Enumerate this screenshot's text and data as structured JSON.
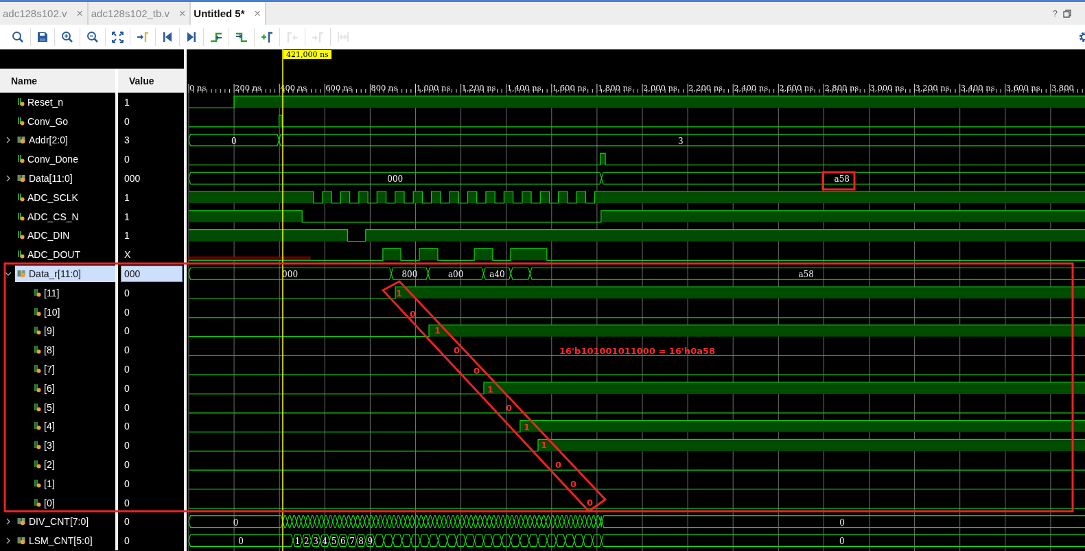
{
  "tabs": [
    {
      "label": "adc128s102.v",
      "close": "×",
      "selected": false
    },
    {
      "label": "adc128s102_tb.v",
      "close": "×",
      "selected": false
    },
    {
      "label": "Untitled 5*",
      "close": "×",
      "selected": true
    }
  ],
  "window_controls": {
    "help": "?"
  },
  "toolbar": [
    {
      "kind": "search",
      "disabled": false
    },
    {
      "kind": "save",
      "disabled": false
    },
    {
      "kind": "zoom-in",
      "disabled": false
    },
    {
      "kind": "zoom-out",
      "disabled": false
    },
    {
      "kind": "zoom-fit",
      "disabled": false
    },
    {
      "kind": "go-to-cursor",
      "disabled": false
    },
    {
      "kind": "go-to-start",
      "disabled": false
    },
    {
      "kind": "go-to-end",
      "disabled": false
    },
    {
      "kind": "previous-transition",
      "disabled": false
    },
    {
      "kind": "next-transition",
      "disabled": false
    },
    {
      "kind": "add-marker",
      "disabled": false
    },
    {
      "kind": "previous-marker",
      "disabled": true
    },
    {
      "kind": "next-marker",
      "disabled": true
    },
    {
      "kind": "swap-markers",
      "disabled": true
    }
  ],
  "header": {
    "name": "Name",
    "value": "Value"
  },
  "cursor": {
    "label": "421,000 ns"
  },
  "ruler": [
    "0 ns",
    "200 ns",
    "400 ns",
    "600 ns",
    "800 ns",
    "1,000 ns",
    "1,200 ns",
    "1,400 ns",
    "1,600 ns",
    "1,800 ns",
    "2,000 ns",
    "2,200 ns",
    "2,400 ns",
    "2,600 ns",
    "2,800 ns",
    "3,000 ns",
    "3,200 ns",
    "3,400 ns",
    "3,600 ns",
    "3,800"
  ],
  "signals": [
    {
      "name": "Reset_n",
      "value": "1",
      "kind": "bit",
      "selected": false
    },
    {
      "name": "Conv_Go",
      "value": "0",
      "kind": "bit",
      "selected": false
    },
    {
      "name": "Addr[2:0]",
      "value": "3",
      "kind": "bus",
      "expanded": false,
      "selected": false,
      "segments": [
        "0",
        "3"
      ]
    },
    {
      "name": "Conv_Done",
      "value": "0",
      "kind": "bit",
      "selected": false
    },
    {
      "name": "Data[11:0]",
      "value": "000",
      "kind": "bus",
      "expanded": false,
      "selected": false,
      "segments": [
        "000",
        "a58"
      ]
    },
    {
      "name": "ADC_SCLK",
      "value": "1",
      "kind": "bit",
      "selected": false
    },
    {
      "name": "ADC_CS_N",
      "value": "1",
      "kind": "bit",
      "selected": false
    },
    {
      "name": "ADC_DIN",
      "value": "1",
      "kind": "bit",
      "selected": false
    },
    {
      "name": "ADC_DOUT",
      "value": "X",
      "kind": "bit",
      "selected": false
    },
    {
      "name": "Data_r[11:0]",
      "value": "000",
      "kind": "bus",
      "expanded": true,
      "selected": true,
      "segments": [
        "000",
        "800",
        "a00",
        "a40",
        "a58"
      ],
      "children": [
        {
          "name": "[11]",
          "value": "0",
          "kind": "bit",
          "selected": false
        },
        {
          "name": "[10]",
          "value": "0",
          "kind": "bit",
          "selected": false
        },
        {
          "name": "[9]",
          "value": "0",
          "kind": "bit",
          "selected": false
        },
        {
          "name": "[8]",
          "value": "0",
          "kind": "bit",
          "selected": false
        },
        {
          "name": "[7]",
          "value": "0",
          "kind": "bit",
          "selected": false
        },
        {
          "name": "[6]",
          "value": "0",
          "kind": "bit",
          "selected": false
        },
        {
          "name": "[5]",
          "value": "0",
          "kind": "bit",
          "selected": false
        },
        {
          "name": "[4]",
          "value": "0",
          "kind": "bit",
          "selected": false
        },
        {
          "name": "[3]",
          "value": "0",
          "kind": "bit",
          "selected": false
        },
        {
          "name": "[2]",
          "value": "0",
          "kind": "bit",
          "selected": false
        },
        {
          "name": "[1]",
          "value": "0",
          "kind": "bit",
          "selected": false
        },
        {
          "name": "[0]",
          "value": "0",
          "kind": "bit",
          "selected": false
        }
      ]
    },
    {
      "name": "DIV_CNT[7:0]",
      "value": "0",
      "kind": "bus",
      "expanded": false,
      "selected": false,
      "segments": [
        "0",
        "0"
      ]
    },
    {
      "name": "LSM_CNT[5:0]",
      "value": "0",
      "kind": "bus",
      "expanded": false,
      "selected": false,
      "segments": [
        "0",
        "1",
        "2",
        "3",
        "4",
        "5",
        "6",
        "7",
        "8",
        "9",
        "0"
      ]
    }
  ],
  "annotations": {
    "bits": [
      "1",
      "0",
      "1",
      "0",
      "0",
      "1",
      "0",
      "1",
      "1",
      "0",
      "0",
      "0"
    ],
    "equation": "16'b101001011000 = 16'h0a58"
  }
}
